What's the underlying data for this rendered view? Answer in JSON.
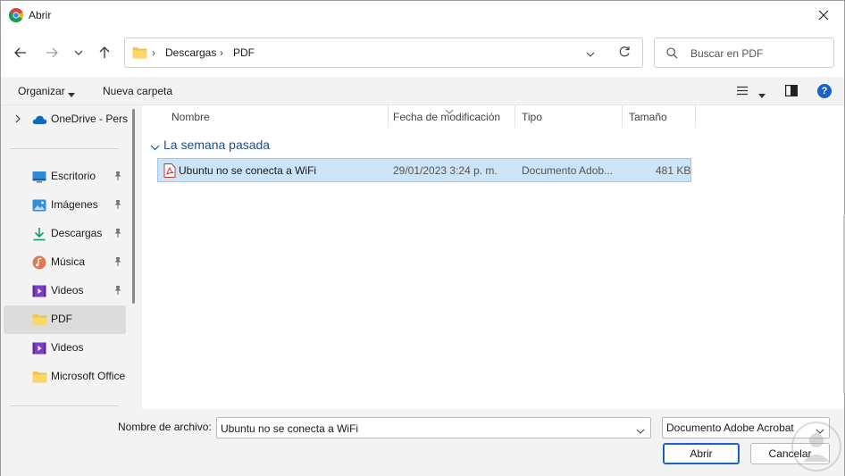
{
  "window": {
    "title": "Abrir"
  },
  "navigation": {
    "breadcrumb": [
      "Descargas",
      "PDF"
    ],
    "search_placeholder": "Buscar en PDF"
  },
  "commandbar": {
    "organize_label": "Organizar",
    "new_folder_label": "Nueva carpeta",
    "help_label": "?"
  },
  "sidebar": {
    "onedrive_label": "OneDrive - Pers",
    "items": [
      {
        "label": "Escritorio",
        "icon": "desktop-icon",
        "pinned": true
      },
      {
        "label": "Imágenes",
        "icon": "pictures-icon",
        "pinned": true
      },
      {
        "label": "Descargas",
        "icon": "downloads-icon",
        "pinned": true
      },
      {
        "label": "Música",
        "icon": "music-icon",
        "pinned": true
      },
      {
        "label": "Videos",
        "icon": "videos-icon",
        "pinned": true
      },
      {
        "label": "PDF",
        "icon": "folder-icon",
        "pinned": false,
        "selected": true
      },
      {
        "label": "Videos",
        "icon": "videos-icon",
        "pinned": false
      },
      {
        "label": "Microsoft Office",
        "icon": "folder-icon",
        "pinned": false
      }
    ]
  },
  "columns": {
    "name": "Nombre",
    "modified": "Fecha de modificación",
    "type": "Tipo",
    "size": "Tamaño"
  },
  "groups": [
    {
      "label": "La semana pasada",
      "files": [
        {
          "name": "Ubuntu no se conecta a WiFi",
          "modified": "29/01/2023 3:24 p. m.",
          "type": "Documento Adob...",
          "size": "481 KB",
          "selected": true
        }
      ]
    }
  ],
  "footer": {
    "filename_label": "Nombre de archivo:",
    "filename_value": "Ubuntu no se conecta a WiFi",
    "filetype_value": "Documento Adobe Acrobat",
    "open_label": "Abrir",
    "cancel_label": "Cancelar"
  },
  "colors": {
    "selection_bg": "#cce4f7",
    "selection_border": "#99c9ef",
    "group_header": "#1e4e8c",
    "accent": "#1a62c6"
  }
}
